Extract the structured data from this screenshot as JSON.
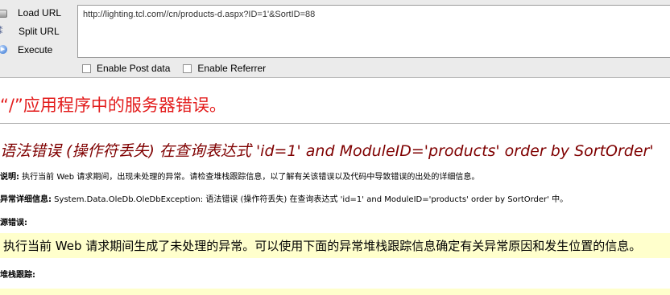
{
  "hackbar": {
    "actions": [
      {
        "label": "Load URL",
        "icon": "load-url-icon"
      },
      {
        "label": "Split URL",
        "icon": "split-url-icon"
      },
      {
        "label": "Execute",
        "icon": "execute-icon"
      }
    ],
    "url_value": "http://lighting.tcl.com//cn/products-d.aspx?ID=1'&SortID=88",
    "options": [
      {
        "label": "Enable Post data",
        "checked": false
      },
      {
        "label": "Enable Referrer",
        "checked": false
      }
    ]
  },
  "error_page": {
    "title": "“/”应用程序中的服务器错误。",
    "subtitle": "语法错误 (操作符丢失) 在查询表达式 'id=1' and ModuleID='products' order by SortOrder'",
    "description_label": "说明:",
    "description_text": " 执行当前 Web 请求期间，出现未处理的异常。请检查堆栈跟踪信息，以了解有关该错误以及代码中导致错误的出处的详细信息。",
    "exception_label": "异常详细信息:",
    "exception_text": " System.Data.OleDb.OleDbException: 语法错误 (操作符丢失) 在查询表达式 'id=1' and ModuleID='products' order by SortOrder' 中。",
    "source_error_label": "源错误:",
    "source_error_text": "执行当前 Web 请求期间生成了未处理的异常。可以使用下面的异常堆栈跟踪信息确定有关异常原因和发生位置的信息。",
    "stack_trace_label": "堆栈跟踪:"
  },
  "colors": {
    "title": "#e31d1d",
    "subtitle": "#7f0000",
    "highlight": "#ffffcc",
    "toolbar": "#ebebeb"
  }
}
